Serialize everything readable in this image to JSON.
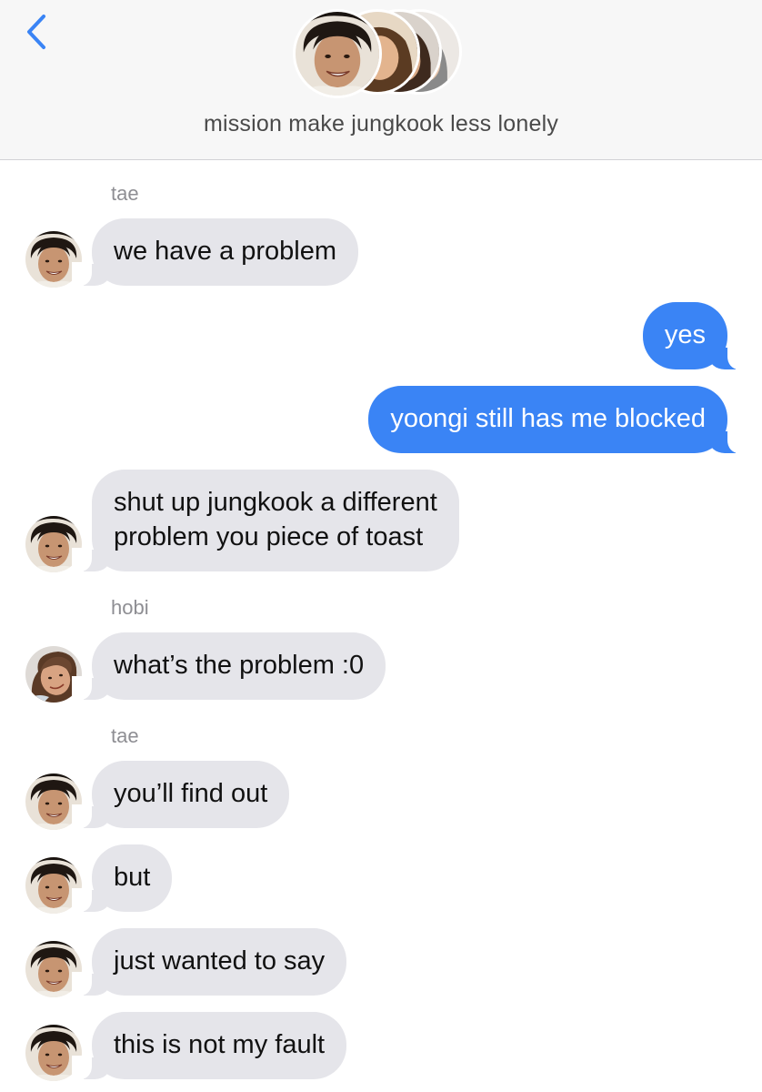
{
  "header": {
    "back_icon": "chevron-left-icon",
    "title": "mission make jungkook less lonely",
    "accent_color": "#3a84f5",
    "group_avatars": [
      "tae",
      "member-2",
      "member-3",
      "member-4"
    ]
  },
  "colors": {
    "incoming_bubble": "#e5e5ea",
    "outgoing_bubble": "#3a84f5",
    "sender_label": "#8e8e93"
  },
  "conversation": {
    "sender_labels": [
      "tae",
      "hobi",
      "tae"
    ],
    "messages": [
      {
        "from": "tae",
        "direction": "incoming",
        "text": "we have a problem"
      },
      {
        "from": "me",
        "direction": "outgoing",
        "text": "yes"
      },
      {
        "from": "me",
        "direction": "outgoing",
        "text": "yoongi still has me blocked"
      },
      {
        "from": "tae",
        "direction": "incoming",
        "lines": [
          "shut up jungkook a different",
          "problem you piece of toast"
        ]
      },
      {
        "from": "hobi",
        "direction": "incoming",
        "text": "what’s the problem :0"
      },
      {
        "from": "tae",
        "direction": "incoming",
        "text": "you’ll find out"
      },
      {
        "from": "tae",
        "direction": "incoming",
        "text": "but"
      },
      {
        "from": "tae",
        "direction": "incoming",
        "text": "just wanted to say"
      },
      {
        "from": "tae",
        "direction": "incoming",
        "text": "this is not my fault"
      }
    ]
  }
}
